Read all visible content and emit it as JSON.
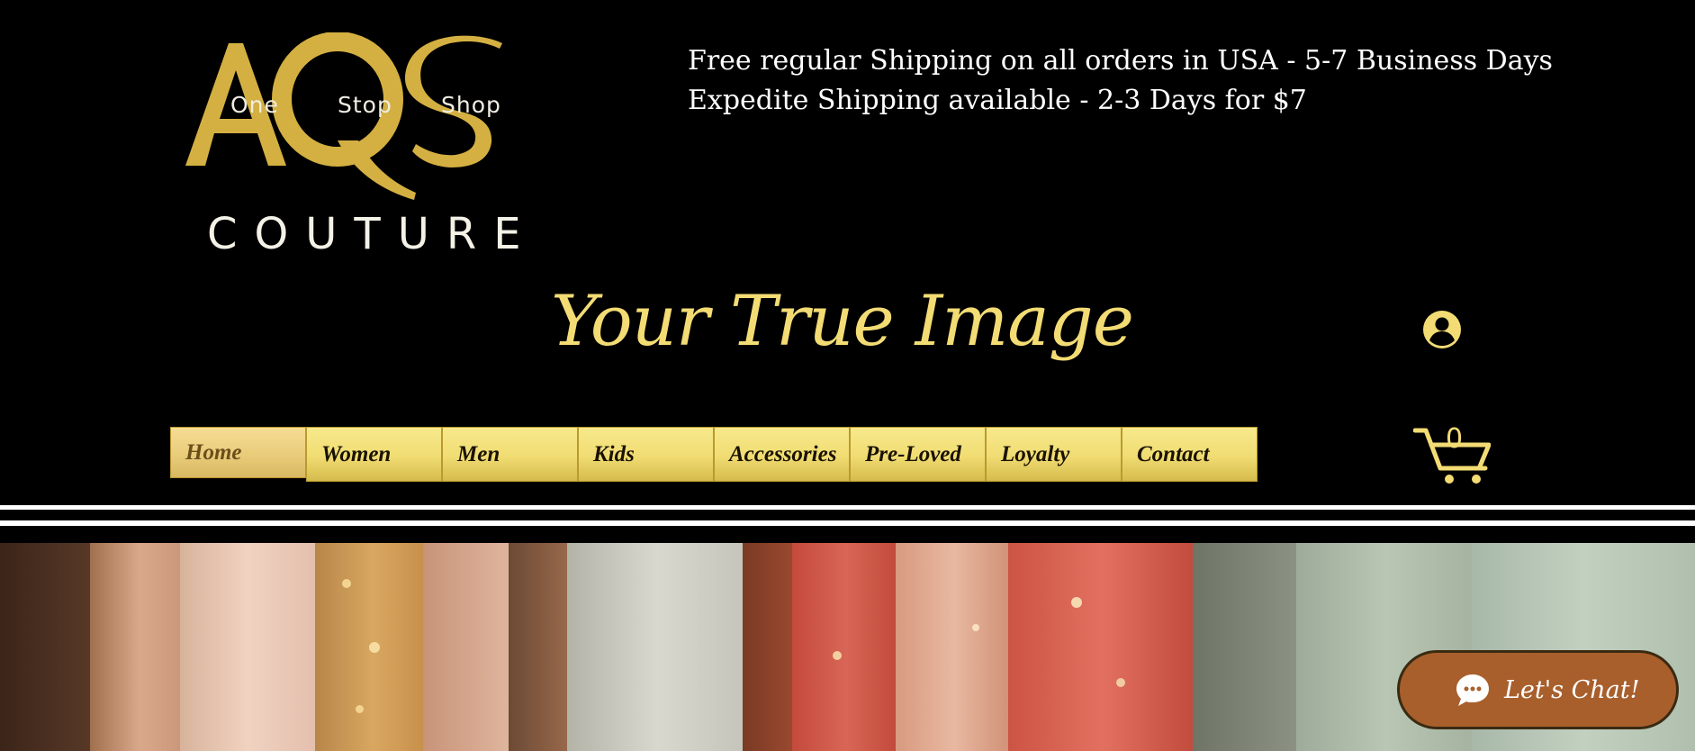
{
  "logo": {
    "letters": "AQS",
    "tagline": [
      "One",
      "Stop",
      "Shop"
    ],
    "wordmark": "COUTURE",
    "gold": "#d4b042"
  },
  "shipping": {
    "line1": "Free regular Shipping on all orders in USA - 5-7 Business Days",
    "line2": "Expedite Shipping available - 2-3 Days for $7"
  },
  "tagline": "Your True Image",
  "nav": {
    "items": [
      {
        "label": "Home",
        "active": true
      },
      {
        "label": "Women"
      },
      {
        "label": "Men"
      },
      {
        "label": "Kids"
      },
      {
        "label": "Accessories"
      },
      {
        "label": "Pre-Loved"
      },
      {
        "label": "Loyalty"
      },
      {
        "label": "Contact"
      }
    ]
  },
  "cart": {
    "count": "0",
    "icon": "cart-icon"
  },
  "account": {
    "icon": "user-account-icon"
  },
  "chat": {
    "label": "Let's Chat!",
    "icon": "chat-bubble-icon",
    "color": "#a85f2c"
  },
  "colors": {
    "background": "#000000",
    "gold": "#f3dc74",
    "nav_gold": "#f0dc72"
  }
}
